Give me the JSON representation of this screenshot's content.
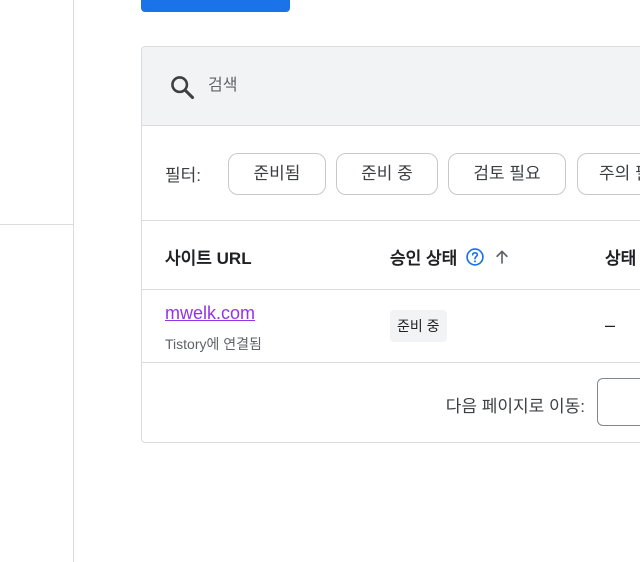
{
  "search": {
    "placeholder": "검색",
    "icon": "search-icon"
  },
  "filters": {
    "label": "필터:",
    "chips": [
      "준비됨",
      "준비 중",
      "검토 필요",
      "주의 필요"
    ]
  },
  "table": {
    "headers": {
      "site_url": "사이트 URL",
      "approval_status": "승인 상태",
      "status": "상태"
    },
    "rows": [
      {
        "site": "mwelk.com",
        "subtitle": "Tistory에 연결됨",
        "approval_status": "준비 중",
        "status": "–"
      }
    ]
  },
  "pagination": {
    "label": "다음 페이지로 이동:",
    "value": ""
  },
  "colors": {
    "accent": "#1a73e8",
    "visited_link": "#9334e6",
    "surface": "#f1f3f4",
    "divider": "#dadce0"
  }
}
